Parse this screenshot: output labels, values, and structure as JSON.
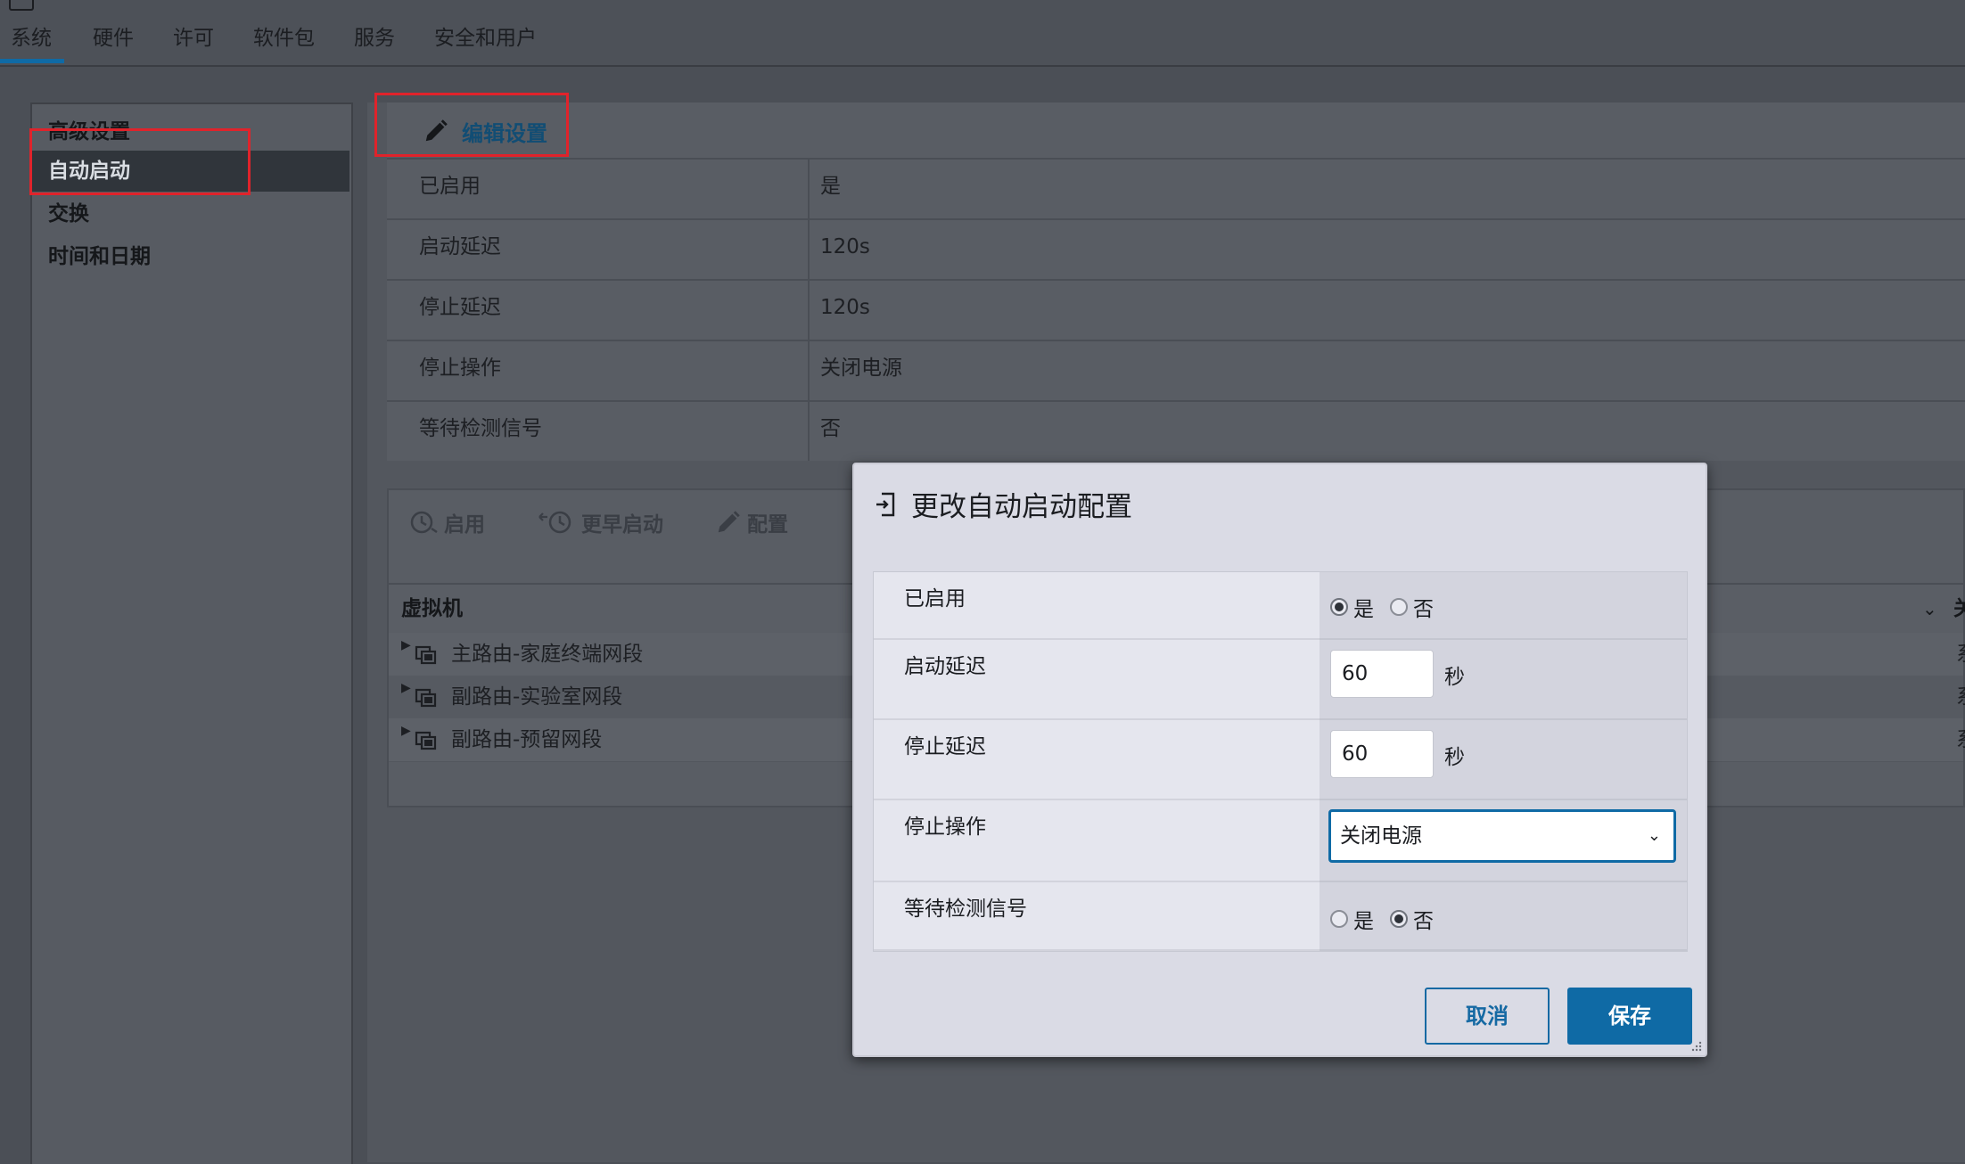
{
  "tabs": [
    "系统",
    "硬件",
    "许可",
    "软件包",
    "服务",
    "安全和用户"
  ],
  "nav": {
    "items": [
      "高级设置",
      "自动启动",
      "交换",
      "时间和日期"
    ]
  },
  "edit_settings": {
    "label": "编辑设置"
  },
  "properties": [
    {
      "key": "已启用",
      "value": "是"
    },
    {
      "key": "启动延迟",
      "value": "120s"
    },
    {
      "key": "停止延迟",
      "value": "120s"
    },
    {
      "key": "停止操作",
      "value": "关闭电源"
    },
    {
      "key": "等待检测信号",
      "value": "否"
    }
  ],
  "vm_toolbar": {
    "enable": "启用",
    "earlier": "更早启动",
    "configure": "配置"
  },
  "vm_table": {
    "col_vm": "虚拟机",
    "col_right": "关",
    "rows": [
      {
        "name": "主路由-家庭终端网段",
        "tail": "系"
      },
      {
        "name": "副路由-实验室网段",
        "tail": "系"
      },
      {
        "name": "副路由-预留网段",
        "tail": "系"
      }
    ]
  },
  "dialog": {
    "title": "更改自动启动配置",
    "enabled": {
      "label": "已启用",
      "yes": "是",
      "no": "否",
      "selected": "是"
    },
    "start_delay": {
      "label": "启动延迟",
      "value": "60",
      "unit": "秒"
    },
    "stop_delay": {
      "label": "停止延迟",
      "value": "60",
      "unit": "秒"
    },
    "stop_action": {
      "label": "停止操作",
      "value": "关闭电源"
    },
    "heartbeat": {
      "label": "等待检测信号",
      "yes": "是",
      "no": "否",
      "selected": "否"
    },
    "cancel": "取消",
    "save": "保存"
  },
  "colors": {
    "accent": "#0f6aa5",
    "highlight_box": "#e0232b",
    "selected_nav_bg": "#30353b"
  }
}
